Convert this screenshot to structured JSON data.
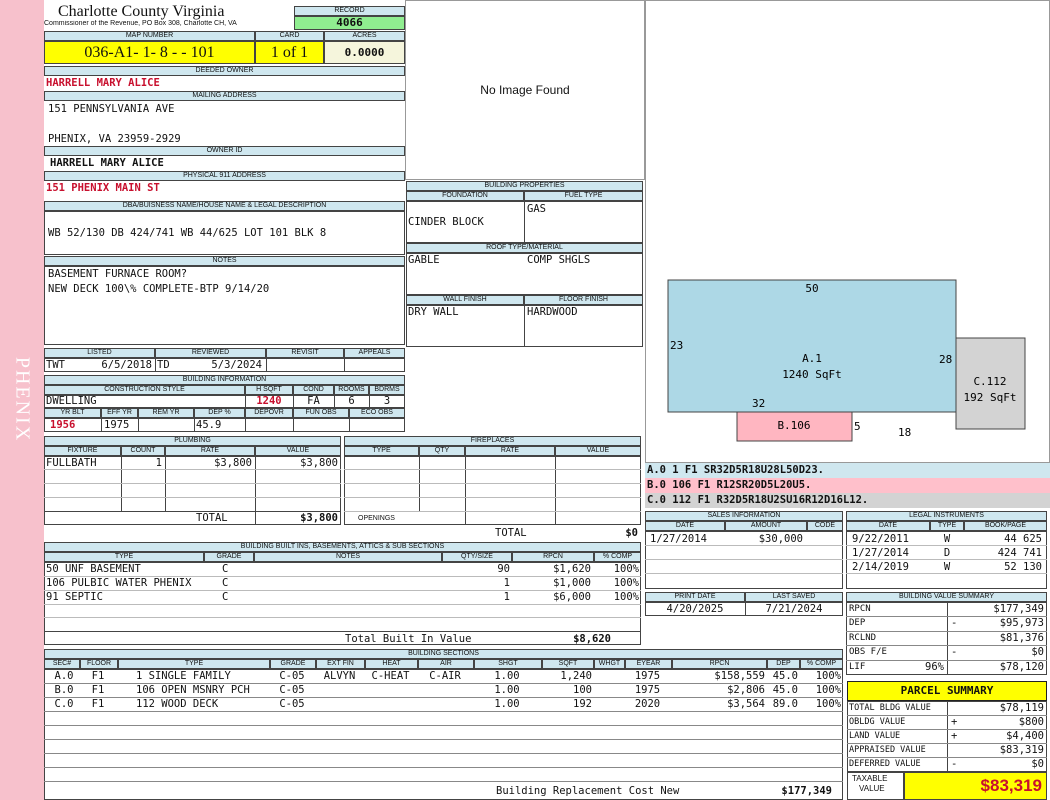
{
  "side_label": "PHENIX",
  "header": {
    "county": "Charlotte County Virginia",
    "commissioner": "Commissioner of the Revenue, PO Box 308, Charlotte CH, VA",
    "record_label": "RECORD",
    "record": "4066",
    "map_label": "MAP NUMBER",
    "map_number": "036-A1- 1- 8 -  - 101",
    "card_label": "CARD",
    "card": "1 of 1",
    "acres_label": "ACRES",
    "acres": "0.0000"
  },
  "owner": {
    "deeded_label": "DEEDED OWNER",
    "deeded_owner": "HARRELL MARY ALICE",
    "mailing_label": "MAILING ADDRESS",
    "mail_line1": "151 PENNSYLVANIA AVE",
    "mail_line3": "PHENIX, VA 23959-2929",
    "owner_id_label": "OWNER ID",
    "owner_id": "HARRELL MARY ALICE",
    "physical_label": "PHYSICAL 911 ADDRESS",
    "physical_address": "151 PHENIX MAIN ST"
  },
  "legal": {
    "label": "DBA/BUISNESS NAME/HOUSE NAME & LEGAL DESCRIPTION",
    "text": "WB 52/130 DB 424/741 WB 44/625 LOT 101 BLK 8"
  },
  "notes": {
    "label": "NOTES",
    "line1": "BASEMENT FURNACE ROOM?",
    "line2": "NEW DECK 100\\% COMPLETE-BTP 9/14/20"
  },
  "image_text": "No Image Found",
  "building_props": {
    "title": "BUILDING PROPERTIES",
    "foundation_label": "FOUNDATION",
    "foundation": "CINDER BLOCK",
    "fuel_label": "FUEL TYPE",
    "fuel": "GAS",
    "roof_label": "ROOF TYPE/MATERIAL",
    "roof_type": "GABLE",
    "roof_material": "COMP SHGLS",
    "wall_label": "WALL FINISH",
    "wall": "DRY WALL",
    "floor_label": "FLOOR FINISH",
    "floor": "HARDWOOD"
  },
  "listing": {
    "listed_label": "LISTED",
    "listed_by": "TWT",
    "listed_date": "6/5/2018",
    "reviewed_label": "REVIEWED",
    "reviewed_by": "TD",
    "reviewed_date": "5/3/2024",
    "revisit_label": "REVISIT",
    "appeals_label": "APPEALS"
  },
  "building_info": {
    "title": "BUILDING INFORMATION",
    "construction_label": "CONSTRUCTION STYLE",
    "construction": "DWELLING",
    "hsqft_label": "H SQFT",
    "hsqft": "1240",
    "cond_label": "COND",
    "cond": "FA",
    "rooms_label": "ROOMS",
    "rooms": "6",
    "bdrms_label": "BDRMS",
    "bdrms": "3",
    "yrblt_label": "YR BLT",
    "yrblt": "1956",
    "effyr_label": "EFF YR",
    "effyr": "1975",
    "remyr_label": "REM YR",
    "dep_label": "DEP %",
    "dep": "45.9",
    "depovr_label": "DEPOVR",
    "funobs_label": "FUN OBS",
    "ecoobs_label": "ECO OBS"
  },
  "plumbing": {
    "title": "PLUMBING",
    "headers": [
      "FIXTURE",
      "COUNT",
      "RATE",
      "VALUE"
    ],
    "rows": [
      [
        "FULLBATH",
        "1",
        "$3,800",
        "$3,800"
      ]
    ],
    "total_label": "TOTAL",
    "total": "$3,800"
  },
  "fireplaces": {
    "title": "FIREPLACES",
    "headers": [
      "TYPE",
      "QTY",
      "RATE",
      "VALUE"
    ],
    "openings_label": "OPENINGS",
    "total_label": "TOTAL",
    "total": "$0"
  },
  "builtins": {
    "title": "BUILDING BUILT INS, BASEMENTS, ATTICS & SUB SECTIONS",
    "headers": [
      "TYPE",
      "GRADE",
      "NOTES",
      "QTY/SIZE",
      "RPCN",
      "% COMP"
    ],
    "rows": [
      [
        "50 UNF BASEMENT",
        "C",
        "",
        "90",
        "$1,620",
        "100%"
      ],
      [
        "106 PULBIC WATER PHENIX",
        "C",
        "",
        "1",
        "$1,000",
        "100%"
      ],
      [
        "91 SEPTIC",
        "C",
        "",
        "1",
        "$6,000",
        "100%"
      ]
    ],
    "total_label": "Total Built In Value",
    "total": "$8,620"
  },
  "sketch": {
    "areas": [
      {
        "label": "A.1",
        "sqft": "1240 SqFt"
      },
      {
        "label": "B.106"
      },
      {
        "label": "C.112",
        "sqft": "192 SqFt"
      }
    ],
    "dims": [
      "50",
      "23",
      "28",
      "32",
      "5",
      "18"
    ],
    "fills": {
      "a": "#add8e6",
      "b": "#ffb6c1",
      "c": "#d3d3d3"
    }
  },
  "sketch_codes": [
    {
      "text": "A.0  1    F1  SR32D5R18U28L50D23.",
      "color": "#cfe7ef"
    },
    {
      "text": "B.0  106  F1  R12SR20D5L20U5.",
      "color": "#ffc0cb"
    },
    {
      "text": "C.0  112  F1  R32D5R18U2SU16R12D16L12.",
      "color": "#d3d3d3"
    }
  ],
  "sales": {
    "title": "SALES INFORMATION",
    "headers": [
      "DATE",
      "AMOUNT",
      "CODE"
    ],
    "rows": [
      [
        "1/27/2014",
        "$30,000",
        ""
      ]
    ]
  },
  "legal_instruments": {
    "title": "LEGAL INSTRUMENTS",
    "headers": [
      "DATE",
      "TYPE",
      "BOOK/PAGE"
    ],
    "rows": [
      [
        "9/22/2011",
        "W",
        "44 625"
      ],
      [
        "1/27/2014",
        "D",
        "424 741"
      ],
      [
        "2/14/2019",
        "W",
        "52 130"
      ]
    ]
  },
  "print": {
    "print_label": "PRINT DATE",
    "print_date": "4/20/2025",
    "saved_label": "LAST SAVED",
    "saved_date": "7/21/2024"
  },
  "value_summary": {
    "title": "BUILDING VALUE SUMMARY",
    "rows": [
      {
        "label": "RPCN",
        "sign": "",
        "value": "$177,349"
      },
      {
        "label": "DEP",
        "sign": "-",
        "value": "$95,973"
      },
      {
        "label": "RCLND",
        "sign": "",
        "value": "$81,376"
      },
      {
        "label": "OBS F/E",
        "sign": "-",
        "value": "$0"
      },
      {
        "label": "LIF",
        "pct": "96%",
        "sign": "",
        "value": "$78,120"
      }
    ]
  },
  "sections": {
    "title": "BUILDING SECTIONS",
    "headers": [
      "SEC#",
      "FLOOR",
      "TYPE",
      "GRADE",
      "EXT FIN",
      "HEAT",
      "AIR",
      "SHGT",
      "SQFT",
      "WHGT",
      "EYEAR",
      "RPCN",
      "DEP",
      "% COMP"
    ],
    "rows": [
      [
        "A.0",
        "F1",
        "1 SINGLE FAMILY",
        "C-05",
        "ALVYN",
        "C-HEAT",
        "C-AIR",
        "1.00",
        "1,240",
        "",
        "1975",
        "$158,559",
        "45.0",
        "100%"
      ],
      [
        "B.0",
        "F1",
        "106 OPEN MSNRY PCH",
        "C-05",
        "",
        "",
        "",
        "1.00",
        "100",
        "",
        "1975",
        "$2,806",
        "45.0",
        "100%"
      ],
      [
        "C.0",
        "F1",
        "112 WOOD DECK",
        "C-05",
        "",
        "",
        "",
        "1.00",
        "192",
        "",
        "2020",
        "$3,564",
        "89.0",
        "100%"
      ]
    ],
    "rcn_label": "Building Replacement Cost New",
    "rcn": "$177,349"
  },
  "parcel": {
    "title": "PARCEL SUMMARY",
    "rows": [
      {
        "label": "TOTAL BLDG VALUE",
        "sign": "",
        "value": "$78,119"
      },
      {
        "label": "OBLDG VALUE",
        "sign": "+",
        "value": "$800"
      },
      {
        "label": "LAND VALUE",
        "sign": "+",
        "value": "$4,400"
      },
      {
        "label": "APPRAISED VALUE",
        "sign": "",
        "value": "$83,319"
      },
      {
        "label": "DEFERRED VALUE",
        "sign": "-",
        "value": "$0"
      }
    ],
    "taxable_label1": "TAXABLE",
    "taxable_label2": "VALUE",
    "taxable": "$83,319"
  }
}
